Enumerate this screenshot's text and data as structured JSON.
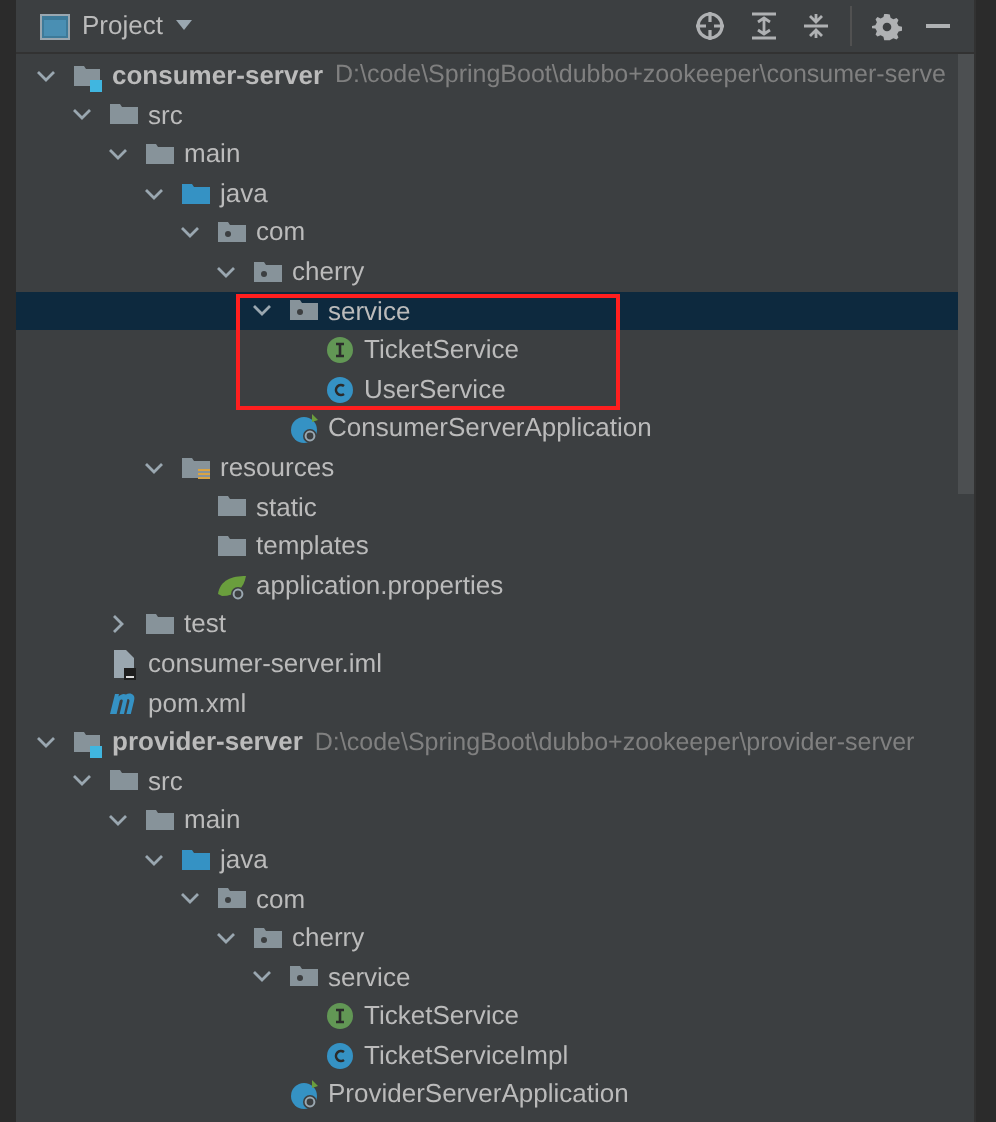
{
  "header": {
    "title": "Project"
  },
  "tree": [
    {
      "kind": "module",
      "label": "consumer-server",
      "path": "D:\\code\\SpringBoot\\dubbo+zookeeper\\consumer-serve",
      "expanded": true,
      "selected": false,
      "children": [
        {
          "kind": "folder",
          "label": "src",
          "expanded": true,
          "selected": false,
          "children": [
            {
              "kind": "folder",
              "label": "main",
              "expanded": true,
              "selected": false,
              "children": [
                {
                  "kind": "source",
                  "label": "java",
                  "expanded": true,
                  "selected": false,
                  "children": [
                    {
                      "kind": "package",
                      "label": "com",
                      "expanded": true,
                      "selected": false,
                      "children": [
                        {
                          "kind": "package",
                          "label": "cherry",
                          "expanded": true,
                          "selected": false,
                          "children": [
                            {
                              "kind": "package",
                              "label": "service",
                              "expanded": true,
                              "selected": true,
                              "framed": true,
                              "children": [
                                {
                                  "kind": "interface",
                                  "label": "TicketService",
                                  "selected": false
                                },
                                {
                                  "kind": "class",
                                  "label": "UserService",
                                  "selected": false
                                }
                              ]
                            },
                            {
                              "kind": "spring",
                              "label": "ConsumerServerApplication",
                              "selected": false
                            }
                          ]
                        }
                      ]
                    }
                  ]
                },
                {
                  "kind": "resources",
                  "label": "resources",
                  "expanded": true,
                  "selected": false,
                  "children": [
                    {
                      "kind": "folder",
                      "label": "static",
                      "selected": false
                    },
                    {
                      "kind": "folder",
                      "label": "templates",
                      "selected": false
                    },
                    {
                      "kind": "properties",
                      "label": "application.properties",
                      "selected": false
                    }
                  ]
                }
              ]
            },
            {
              "kind": "folder",
              "label": "test",
              "expanded": false,
              "selected": false
            }
          ]
        },
        {
          "kind": "iml",
          "label": "consumer-server.iml",
          "selected": false
        },
        {
          "kind": "maven",
          "label": "pom.xml",
          "selected": false
        }
      ]
    },
    {
      "kind": "module",
      "label": "provider-server",
      "path": "D:\\code\\SpringBoot\\dubbo+zookeeper\\provider-server",
      "expanded": true,
      "selected": false,
      "children": [
        {
          "kind": "folder",
          "label": "src",
          "expanded": true,
          "selected": false,
          "children": [
            {
              "kind": "folder",
              "label": "main",
              "expanded": true,
              "selected": false,
              "children": [
                {
                  "kind": "source",
                  "label": "java",
                  "expanded": true,
                  "selected": false,
                  "children": [
                    {
                      "kind": "package",
                      "label": "com",
                      "expanded": true,
                      "selected": false,
                      "children": [
                        {
                          "kind": "package",
                          "label": "cherry",
                          "expanded": true,
                          "selected": false,
                          "children": [
                            {
                              "kind": "package",
                              "label": "service",
                              "expanded": true,
                              "selected": false,
                              "children": [
                                {
                                  "kind": "interface",
                                  "label": "TicketService",
                                  "selected": false
                                },
                                {
                                  "kind": "class",
                                  "label": "TicketServiceImpl",
                                  "selected": false
                                }
                              ]
                            },
                            {
                              "kind": "spring",
                              "label": "ProviderServerApplication",
                              "selected": false
                            }
                          ]
                        }
                      ]
                    }
                  ]
                }
              ]
            }
          ]
        }
      ]
    }
  ]
}
